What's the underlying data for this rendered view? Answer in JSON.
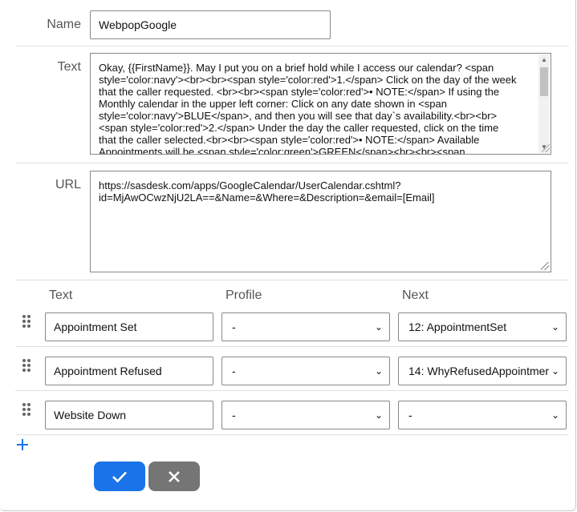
{
  "form": {
    "name_label": "Name",
    "name_value": "WebpopGoogle",
    "text_label": "Text",
    "text_lines": [
      "Okay, {{FirstName}}. May I put you on a brief hold while I access our calendar? <span",
      "style='color:navy'><br><br><span style='color:red'>1.</span> Click on the day of the week",
      "that the caller requested. <br><br><span style='color:red'>• NOTE:</span> If using the",
      "Monthly calendar in the upper left corner: Click on any date shown in <span",
      "style='color:navy'>BLUE</span>, and then you will see that day`s availability.<br><br>",
      "<span style='color:red'>2.</span> Under the day the caller requested, click on the time",
      "that the caller selected.<br><br><span style='color:red'>• NOTE:</span> Available",
      "Appointments will be <span style='color:green'>GREEN</span><br><br><span"
    ],
    "url_label": "URL",
    "url_lines": [
      "https://sasdesk.com/apps/GoogleCalendar/UserCalendar.cshtml?",
      "id=MjAwOCwzNjU2LA==&Name=&Where=&Description=&email=[Email]"
    ]
  },
  "responses": {
    "headers": {
      "text": "Text",
      "profile": "Profile",
      "next": "Next"
    },
    "rows": [
      {
        "text": "Appointment Set",
        "profile": "-",
        "next": "12: AppointmentSet"
      },
      {
        "text": "Appointment Refused",
        "profile": "-",
        "next": "14: WhyRefusedAppointmer"
      },
      {
        "text": "Website Down",
        "profile": "-",
        "next": "-"
      }
    ]
  },
  "actions": {
    "add_icon": "plus-icon",
    "confirm_icon": "check-icon",
    "cancel_icon": "close-icon"
  },
  "colors": {
    "primary": "#1a73e8",
    "secondary": "#757575"
  }
}
